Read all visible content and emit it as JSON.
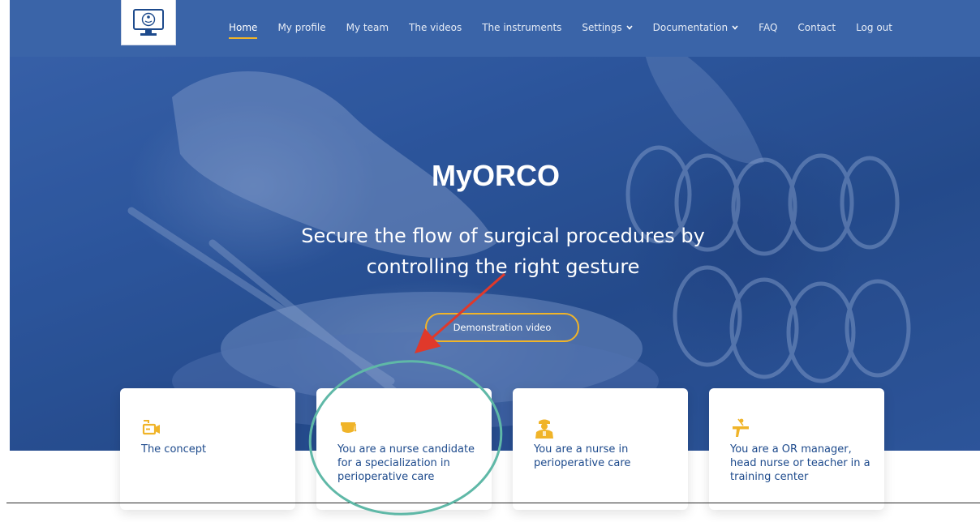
{
  "nav": {
    "items": [
      {
        "label": "Home",
        "active": true,
        "dropdown": false
      },
      {
        "label": "My profile",
        "active": false,
        "dropdown": false
      },
      {
        "label": "My team",
        "active": false,
        "dropdown": false
      },
      {
        "label": "The videos",
        "active": false,
        "dropdown": false
      },
      {
        "label": "The instruments",
        "active": false,
        "dropdown": false
      },
      {
        "label": "Settings",
        "active": false,
        "dropdown": true
      },
      {
        "label": "Documentation",
        "active": false,
        "dropdown": true
      },
      {
        "label": "FAQ",
        "active": false,
        "dropdown": false
      },
      {
        "label": "Contact",
        "active": false,
        "dropdown": false
      },
      {
        "label": "Log out",
        "active": false,
        "dropdown": false
      }
    ]
  },
  "hero": {
    "title": "MyORCO",
    "subtitle": "Secure the flow of surgical procedures by controlling the right gesture",
    "button_label": "Demonstration video"
  },
  "cards": [
    {
      "icon": "camera-icon",
      "label": "The concept"
    },
    {
      "icon": "graduation-cap-icon",
      "label": "You are a nurse candidate for a specialization in perioperative care"
    },
    {
      "icon": "nurse-icon",
      "label": "You are a nurse in perioperative care"
    },
    {
      "icon": "teacher-icon",
      "label": "You are a OR manager, head nurse or teacher in a training center"
    }
  ],
  "colors": {
    "nav_bg": "#3a64a8",
    "accent": "#f0b429",
    "card_text": "#1d4a8c",
    "annotation_arrow": "#e0392b",
    "annotation_circle": "#5fb8a7"
  }
}
